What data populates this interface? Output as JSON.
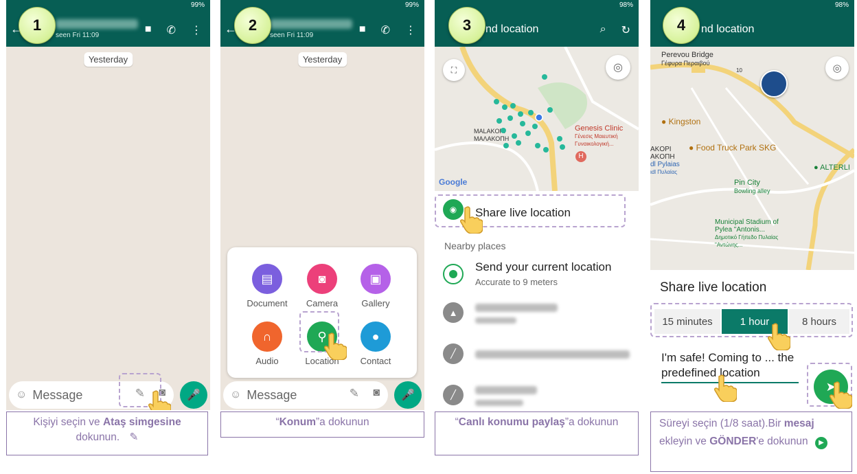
{
  "colors": {
    "header": "#075e54",
    "accent": "#00a884",
    "caption_border": "#8a74a8",
    "highlight": "#b8a3cf"
  },
  "steps": [
    {
      "number": "1",
      "header_subtitle": "seen Fri 11:09",
      "day_chip": "Yesterday",
      "message_placeholder": "Message",
      "caption": {
        "pre": "Kişiyi seçin ve ",
        "bold": "Ataş simgesine",
        "post": " dokunun."
      }
    },
    {
      "number": "2",
      "header_subtitle": "seen Fri 11:09",
      "day_chip": "Yesterday",
      "message_placeholder": "Message",
      "attach_items": [
        {
          "label": "Document",
          "icon": "document-icon",
          "color": "#7b5fde"
        },
        {
          "label": "Camera",
          "icon": "camera-icon",
          "color": "#ec407a"
        },
        {
          "label": "Gallery",
          "icon": "gallery-icon",
          "color": "#b561e8"
        },
        {
          "label": "Audio",
          "icon": "headphones-icon",
          "color": "#f0652d"
        },
        {
          "label": "Location",
          "icon": "location-pin-icon",
          "color": "#1fa855"
        },
        {
          "label": "Contact",
          "icon": "contact-icon",
          "color": "#1e9bd7"
        }
      ],
      "caption": {
        "pre": "“",
        "bold": "Konum",
        "post": "”a dokunun"
      }
    },
    {
      "number": "3",
      "title": "nd location",
      "map_labels": {
        "area": "MALAKOPI",
        "area_greek": "ΜΑΛΑΚΟΠΗ",
        "clinic": "Genesis Clinic",
        "clinic_greek": "Γένεσις Μαιευτική Γυναικολογική...",
        "google": "Google",
        "hospital": "H"
      },
      "share_live": "Share live location",
      "nearby_header": "Nearby places",
      "current_location": {
        "title": "Send your current location",
        "subtitle": "Accurate to 9 meters"
      },
      "caption": {
        "pre": "“",
        "bold": "Canlı konumu paylaş",
        "post": "”a dokunun"
      }
    },
    {
      "number": "4",
      "title": "nd location",
      "map_labels": {
        "bridge": "Perevou Bridge",
        "bridge_greek": "Γέφυρα Περαιβού",
        "route": "10",
        "kingston": "Kingston",
        "food_truck": "Food Truck Park SKG",
        "pin_city": "Pin City",
        "pin_city_sub": "Bowling alley",
        "stadium": "Municipal Stadium of Pylea \"Antonis...",
        "stadium_greek": "Δημοτικό Γήπεδο Πυλαίας \"Αντώνης...",
        "akopi": "AKOPI",
        "akopi_greek": "AKOΠΗ",
        "pylaias": "dl Pylaias",
        "pylaias_greek": "ιdl Πυλαίας",
        "alterli": "ALTERLI"
      },
      "share_live": "Share live location",
      "durations": [
        "15 minutes",
        "1 hour",
        "8 hours"
      ],
      "comment": "I'm safe! Coming to ... the predefined location",
      "caption": {
        "pre": "Süreyi seçin (1/8 saat).Bir ",
        "bold1": "mesaj",
        "mid": " ekleyin ve ",
        "bold2": "GÖNDER",
        "post": "'e dokunun"
      }
    }
  ],
  "status": {
    "left": "99%",
    "right": "98%"
  }
}
